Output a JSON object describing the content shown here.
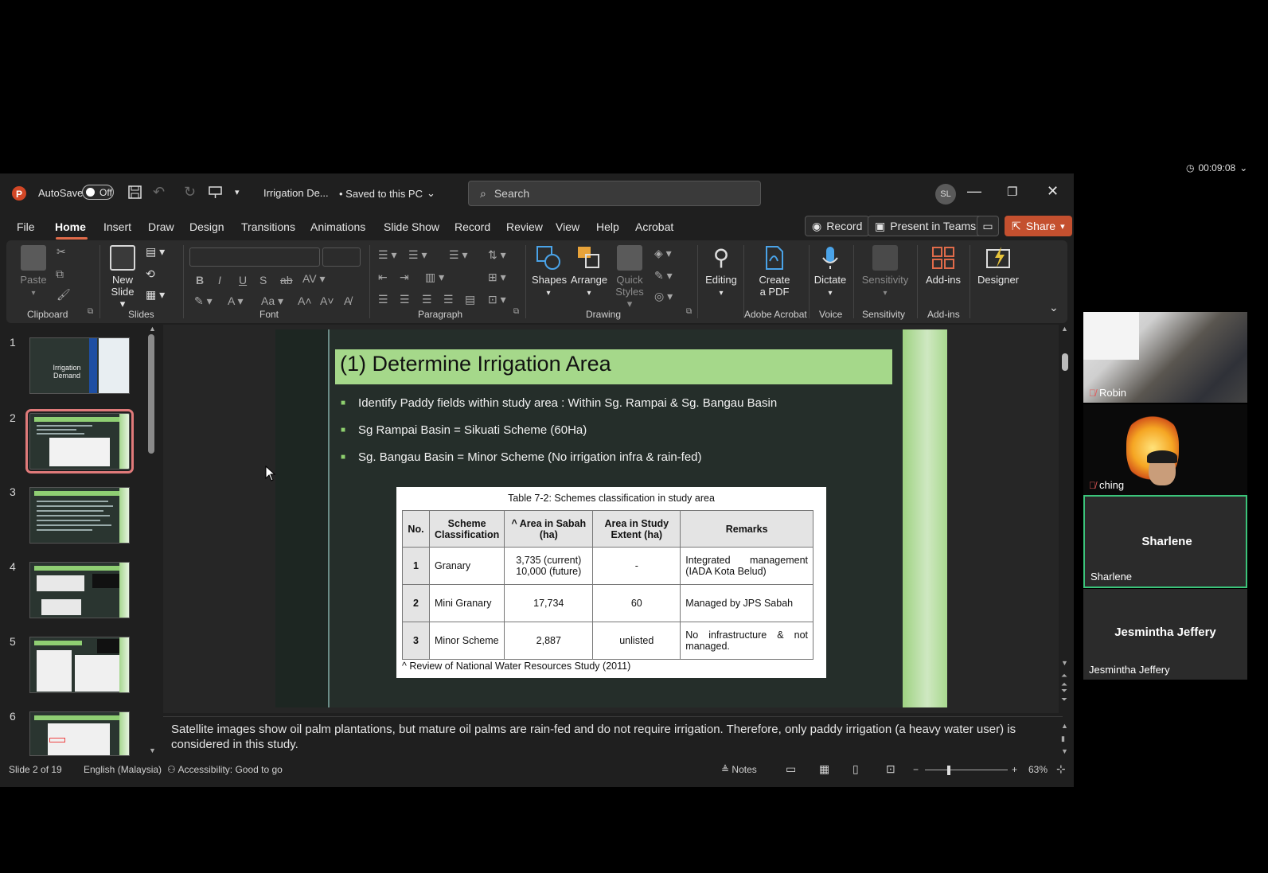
{
  "meeting": {
    "timer": "00:09:08"
  },
  "titlebar": {
    "autosave_label": "AutoSave",
    "autosave_state": "Off",
    "filename": "Irrigation De...",
    "save_status": "• Saved to this PC",
    "search_placeholder": "Search",
    "user_initials": "SL"
  },
  "menu": {
    "items": [
      "File",
      "Home",
      "Insert",
      "Draw",
      "Design",
      "Transitions",
      "Animations",
      "Slide Show",
      "Record",
      "Review",
      "View",
      "Help",
      "Acrobat"
    ],
    "active": "Home",
    "record_btn": "Record",
    "present_btn": "Present in Teams",
    "share_btn": "Share"
  },
  "ribbon": {
    "clipboard": {
      "paste": "Paste",
      "label": "Clipboard"
    },
    "slides": {
      "new_slide_line1": "New",
      "new_slide_line2": "Slide",
      "label": "Slides"
    },
    "font": {
      "label": "Font"
    },
    "paragraph": {
      "label": "Paragraph"
    },
    "drawing": {
      "shapes": "Shapes",
      "arrange": "Arrange",
      "quick_line1": "Quick",
      "quick_line2": "Styles",
      "label": "Drawing"
    },
    "editing": {
      "label": "Editing"
    },
    "acrobat": {
      "line1": "Create",
      "line2": "a PDF",
      "label": "Adobe Acrobat"
    },
    "voice": {
      "dictate": "Dictate",
      "label": "Voice"
    },
    "sensitivity": {
      "btn": "Sensitivity",
      "label": "Sensitivity"
    },
    "addins": {
      "btn": "Add-ins",
      "label": "Add-ins"
    },
    "designer": {
      "btn": "Designer"
    }
  },
  "thumbnails": {
    "numbers": [
      "1",
      "2",
      "3",
      "4",
      "5",
      "6"
    ],
    "slide1_text": "Irrigation Demand"
  },
  "slide": {
    "title": "(1) Determine Irrigation Area",
    "bullets": [
      "Identify Paddy fields within study area : Within Sg. Rampai & Sg. Bangau Basin",
      "Sg Rampai Basin = Sikuati Scheme (60Ha)",
      "Sg. Bangau Basin = Minor Scheme (No irrigation infra & rain-fed)"
    ],
    "table": {
      "caption": "Table 7-2: Schemes classification in study area",
      "headers": [
        "No.",
        "Scheme Classification",
        "^ Area in Sabah (ha)",
        "Area in Study Extent (ha)",
        "Remarks"
      ],
      "rows": [
        [
          "1",
          "Granary",
          "3,735 (current)\n10,000 (future)",
          "-",
          "Integrated management (IADA Kota Belud)"
        ],
        [
          "2",
          "Mini Granary",
          "17,734",
          "60",
          "Managed by JPS Sabah"
        ],
        [
          "3",
          "Minor Scheme",
          "2,887",
          "unlisted",
          "No infrastructure & not managed."
        ]
      ],
      "source": "^ Review of National Water Resources Study (2011)"
    }
  },
  "notes": {
    "text": "Satellite images show oil palm plantations, but mature oil palms are rain-fed and do not require irrigation. Therefore, only paddy irrigation (a heavy water user) is considered in this study."
  },
  "statusbar": {
    "slide_info": "Slide 2 of 19",
    "language": "English (Malaysia)",
    "accessibility": "Accessibility: Good to go",
    "notes_btn": "Notes",
    "zoom": "63%"
  },
  "participants": [
    {
      "name": "Robin",
      "muted": true
    },
    {
      "name": "ching",
      "muted": true
    },
    {
      "name": "Sharlene",
      "speaking": true
    },
    {
      "name": "Jesmintha Jeffery"
    }
  ],
  "colors": {
    "accent": "#e06b4a",
    "share": "#c4502f",
    "slide_green": "#a5d88a",
    "speaking": "#3bc47a"
  }
}
